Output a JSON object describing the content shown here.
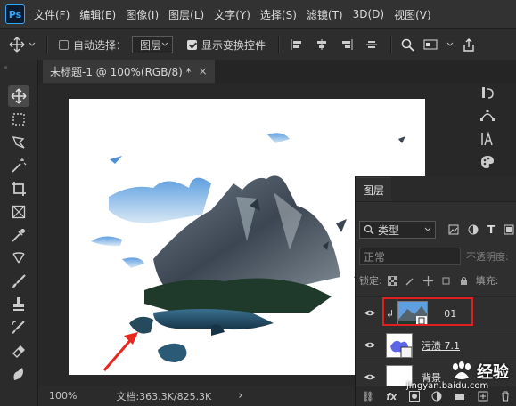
{
  "app": {
    "logo": "Ps"
  },
  "menu": [
    "文件(F)",
    "编辑(E)",
    "图像(I)",
    "图层(L)",
    "文字(Y)",
    "选择(S)",
    "滤镜(T)",
    "3D(D)",
    "视图(V)"
  ],
  "options": {
    "auto_select_label": "自动选择：",
    "auto_select_checked": false,
    "auto_select_target": "图层",
    "show_transform_label": "显示变换控件",
    "show_transform_checked": true
  },
  "document": {
    "tab_title": "未标题-1 @ 100%(RGB/8) *",
    "close": "×"
  },
  "status": {
    "zoom": "100%",
    "doc_info": "文档:363.3K/825.3K",
    "arrow": "›"
  },
  "layers_panel": {
    "tab": "图层",
    "filter_label": "类型",
    "blend_mode": "正常",
    "opacity_label": "不透明度:",
    "lock_label": "锁定:",
    "fill_label": "填充:",
    "layers": [
      {
        "name": "01",
        "visible": true,
        "clipped": true,
        "highlighted": true
      },
      {
        "name": "污渍 7.1",
        "visible": true,
        "clipped": false,
        "highlighted": false
      },
      {
        "name": "背景",
        "visible": true,
        "clipped": false,
        "highlighted": false
      }
    ]
  },
  "watermark": {
    "text": "经验",
    "url": "jingyan.baidu.com"
  },
  "colors": {
    "accent": "#31a8ff",
    "highlight_box": "#e02020",
    "annotation_arrow": "#e8271e"
  },
  "icons": {
    "tools": [
      "move-icon",
      "marquee-icon",
      "lasso-icon",
      "magic-wand-icon",
      "crop-icon",
      "frame-icon",
      "eyedropper-icon",
      "healing-brush-icon",
      "brush-icon",
      "stamp-icon",
      "history-brush-icon",
      "eraser-icon",
      "smudge-icon"
    ],
    "right": [
      "history-icon",
      "paths-icon",
      "character-icon",
      "swatches-icon"
    ]
  }
}
